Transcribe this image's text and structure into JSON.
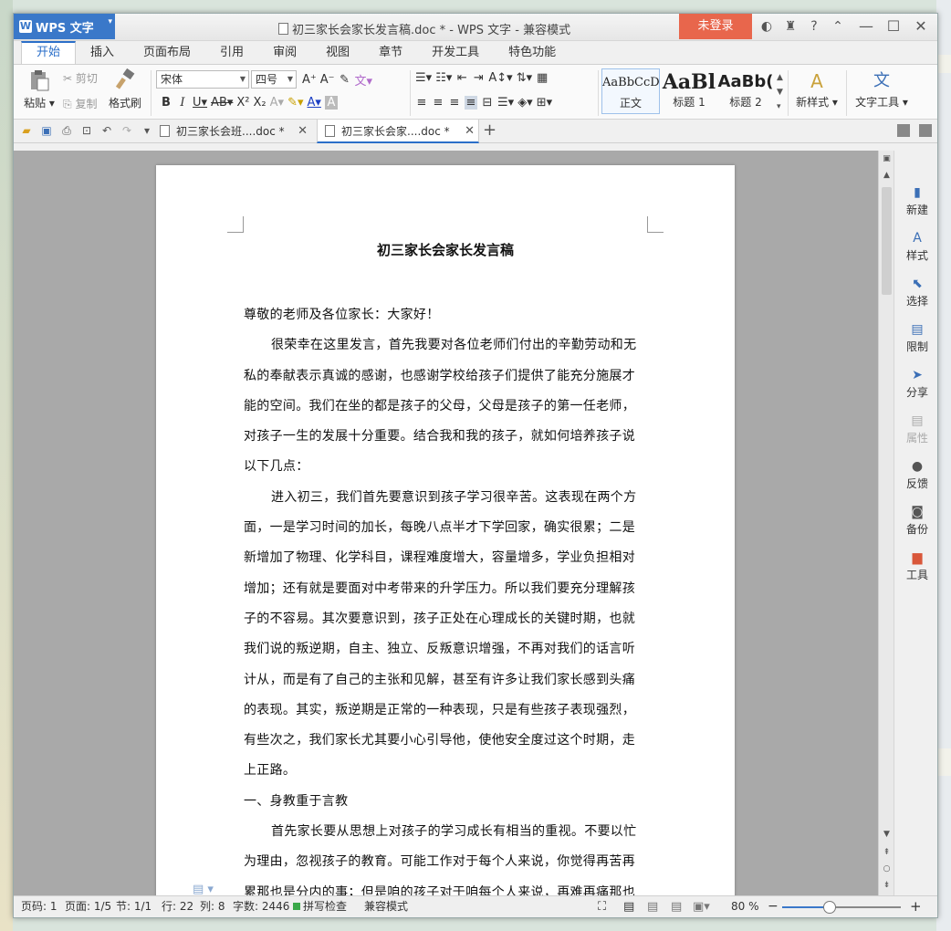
{
  "app": {
    "app_button": "WPS 文字",
    "window_title": "初三家长会家长发言稿.doc * - WPS 文字 - 兼容模式",
    "login": "未登录",
    "help": "?"
  },
  "ribbon_tabs": [
    "开始",
    "插入",
    "页面布局",
    "引用",
    "审阅",
    "视图",
    "章节",
    "开发工具",
    "特色功能"
  ],
  "ribbon": {
    "paste": "粘贴",
    "cut": "剪切",
    "copy": "复制",
    "format_painter": "格式刷",
    "font_name": "宋体",
    "font_size": "四号",
    "styles": [
      {
        "sample": "AaBbCcD",
        "name": "正文"
      },
      {
        "sample": "AaBl",
        "name": "标题 1"
      },
      {
        "sample": "AaBb(",
        "name": "标题 2"
      }
    ],
    "new_style": "新样式",
    "text_tools": "文字工具"
  },
  "doc_tabs": [
    {
      "label": "初三家长会班....doc *",
      "active": false
    },
    {
      "label": "初三家长会家....doc *",
      "active": true
    }
  ],
  "document": {
    "title": "初三家长会家长发言稿",
    "lines": [
      {
        "text": "尊敬的老师及各位家长：大家好！",
        "indent": false
      },
      {
        "text": "很荣幸在这里发言，首先我要对各位老师们付出的辛勤劳动和无",
        "indent": true
      },
      {
        "text": "私的奉献表示真诚的感谢，也感谢学校给孩子们提供了能充分施展才",
        "indent": false
      },
      {
        "text": "能的空间。我们在坐的都是孩子的父母，父母是孩子的第一任老师，",
        "indent": false
      },
      {
        "text": "对孩子一生的发展十分重要。结合我和我的孩子，就如何培养孩子说",
        "indent": false
      },
      {
        "text": "以下几点：",
        "indent": false
      },
      {
        "text": "进入初三，我们首先要意识到孩子学习很辛苦。这表现在两个方",
        "indent": true
      },
      {
        "text": "面，一是学习时间的加长，每晚八点半才下学回家，确实很累；二是",
        "indent": false
      },
      {
        "text": "新增加了物理、化学科目，课程难度增大，容量增多，学业负担相对",
        "indent": false
      },
      {
        "text": "增加；还有就是要面对中考带来的升学压力。所以我们要充分理解孩",
        "indent": false
      },
      {
        "text": "子的不容易。其次要意识到，孩子正处在心理成长的关键时期，也就",
        "indent": false
      },
      {
        "text": "我们说的叛逆期，自主、独立、反叛意识增强，不再对我们的话言听",
        "indent": false
      },
      {
        "text": "计从，而是有了自己的主张和见解，甚至有许多让我们家长感到头痛",
        "indent": false
      },
      {
        "text": "的表现。其实，叛逆期是正常的一种表现，只是有些孩子表现强烈，",
        "indent": false
      },
      {
        "text": "有些次之，我们家长尤其要小心引导他，使他安全度过这个时期，走",
        "indent": false
      },
      {
        "text": "上正路。",
        "indent": false
      },
      {
        "text": "一、身教重于言教",
        "indent": false
      },
      {
        "text": "首先家长要从思想上对孩子的学习成长有相当的重视。不要以忙",
        "indent": true
      },
      {
        "text": "为理由，忽视孩子的教育。可能工作对于每个人来说，你觉得再苦再",
        "indent": false
      },
      {
        "text": "累那也是分内的事；但是咱的孩子对于咱每个人来说，再难再痛那也",
        "indent": false
      }
    ]
  },
  "task_pane": [
    "新建",
    "样式",
    "选择",
    "限制",
    "分享",
    "属性",
    "反馈",
    "备份",
    "工具"
  ],
  "status": {
    "page_code": "页码: 1",
    "page": "页面: 1/5",
    "section": "节: 1/1",
    "row": "行: 22",
    "col": "列: 8",
    "word_count": "字数: 2446",
    "spell_check": "拼写检查",
    "compat_mode": "兼容模式",
    "zoom": "80 %",
    "zoom_fraction": 0.4
  }
}
